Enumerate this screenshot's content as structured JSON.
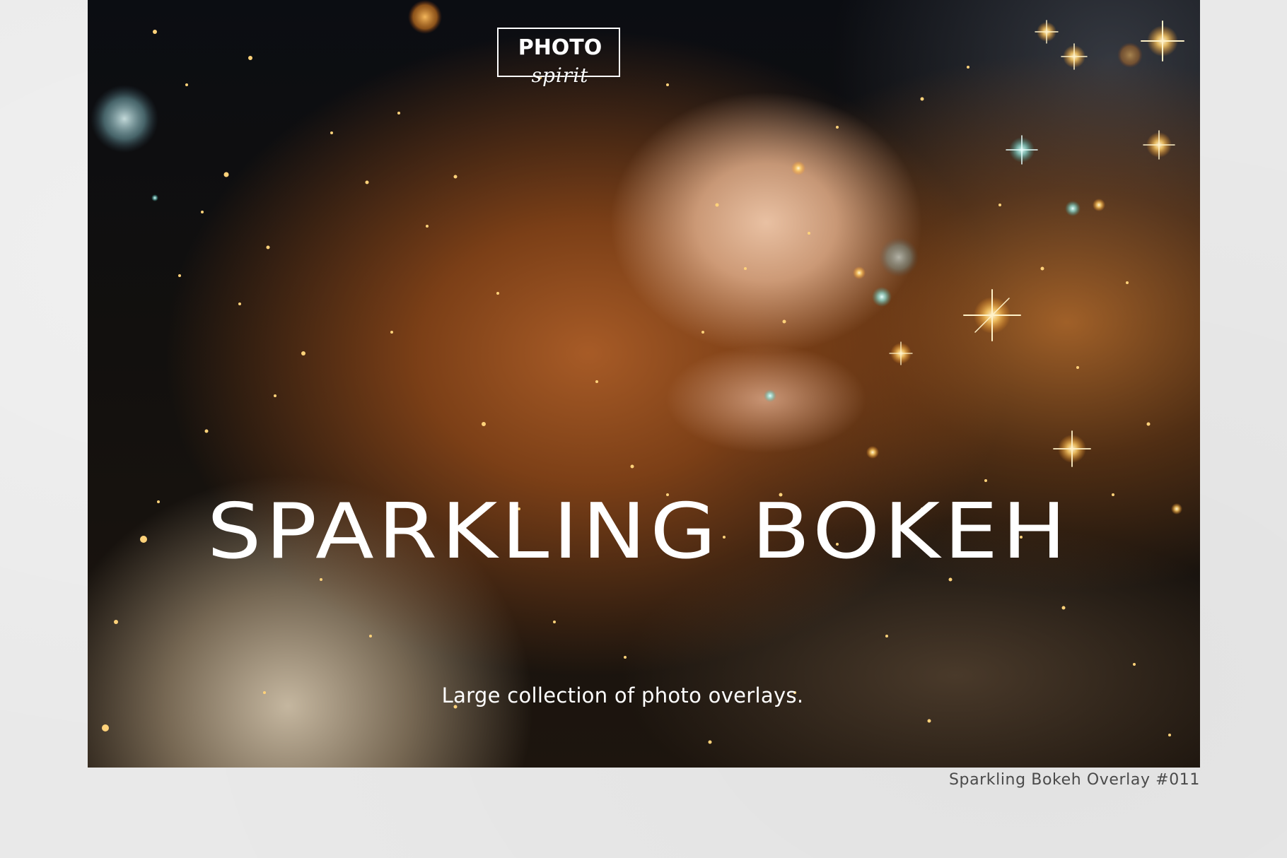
{
  "logo": {
    "main": "PHOTO",
    "script": "spirit"
  },
  "hero": {
    "headline": "SPARKLING BOKEH",
    "tagline": "Large collection of photo overlays."
  },
  "caption": "Sparkling Bokeh Overlay #011",
  "colors": {
    "page_background": "#e9e9e9",
    "hero_text": "#ffffff",
    "caption_text": "#4a4a4a",
    "sparkle_gold": "#ffcf6a",
    "sparkle_teal": "#8fe8e0"
  }
}
